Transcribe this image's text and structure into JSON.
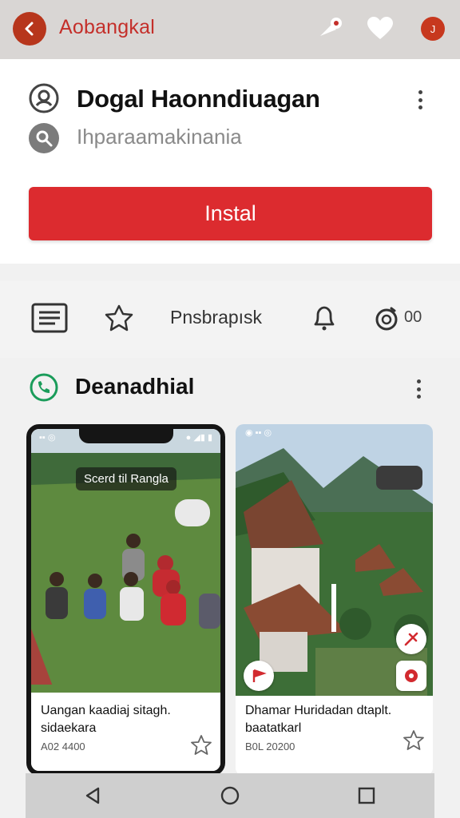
{
  "appbar": {
    "title": "Aobangkal"
  },
  "app": {
    "name": "Dogal Haonndiuagan",
    "subtitle": "Ihparaamakinania",
    "install_label": "Instal"
  },
  "toolbar": {
    "label": "Pnsbrapısk",
    "count": "00"
  },
  "section": {
    "title": "Deanadhial"
  },
  "cards": [
    {
      "overlay": "Scerd til Rangla",
      "caption_line1": "Uangan kaadiaj sitagh.",
      "caption_line2": "sidaekara",
      "meta": "A02 4400"
    },
    {
      "caption_line1": "Dhamar Huridadan dtaplt.",
      "caption_line2": "baatatkarl",
      "meta": "B0L 20200"
    }
  ],
  "colors": {
    "accent_red": "#dc2b2f",
    "title_red": "#c42f2a",
    "appbar_bg": "#d9d6d4",
    "section_icon_green": "#1a9c5a"
  },
  "icons": {
    "back": "chevron-left-icon",
    "share": "share-icon",
    "favorite": "heart-icon",
    "profile": "profile-icon",
    "app": "app-logo-icon",
    "search": "search-icon",
    "list": "list-icon",
    "star": "star-icon",
    "bell": "bell-icon",
    "timer": "timer-icon",
    "section": "phone-icon",
    "more": "more-vert-icon"
  }
}
